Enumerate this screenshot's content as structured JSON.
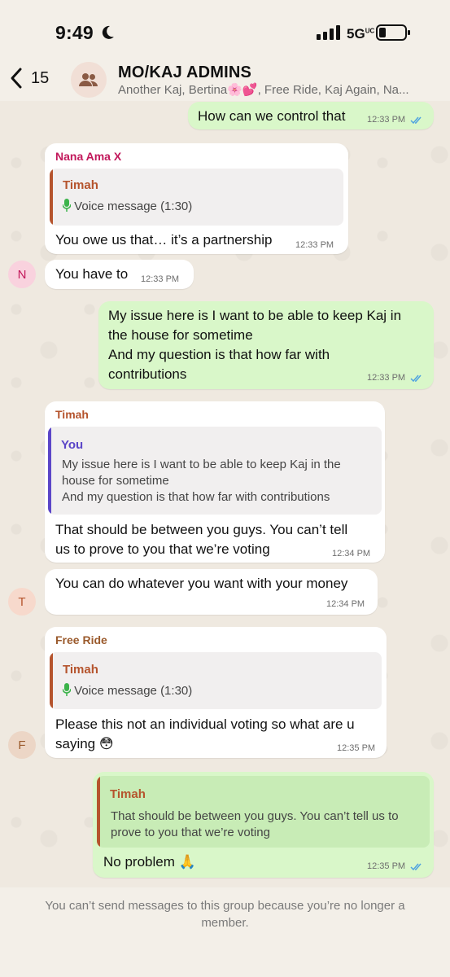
{
  "status_bar": {
    "time": "9:49",
    "network": "5G",
    "network_sup": "UC"
  },
  "header": {
    "back_count": "15",
    "title": "MO/KAJ ADMINS",
    "members": "Another Kaj, Bertina🌸💕, Free Ride, Kaj Again, Na..."
  },
  "messages": [
    {
      "text": "How can we control that",
      "time": "12:33 PM"
    },
    {
      "sender": "Nana Ama X",
      "quote_name": "Timah",
      "quote_text": "Voice message (1:30)",
      "text": "You owe us that… it’s a partnership",
      "time": "12:33 PM"
    },
    {
      "text": "You have to",
      "time": "12:33 PM",
      "avatar": "N"
    },
    {
      "lines": [
        "My issue here is I want to be able to keep Kaj in",
        "the house for sometime",
        "And my question is that how far with",
        "contributions"
      ],
      "time": "12:33 PM"
    },
    {
      "sender": "Timah",
      "quote_name": "You",
      "quote_lines": [
        "My issue here is I want to be able to keep Kaj in the",
        "house for sometime",
        "And my question is that how far with contributions"
      ],
      "lines": [
        "That should be between you guys. You can’t tell",
        "us to prove to you that we’re voting"
      ],
      "time": "12:34 PM"
    },
    {
      "text": "You can do whatever you want with your money",
      "time": "12:34 PM",
      "avatar": "T"
    },
    {
      "sender": "Free Ride",
      "quote_name": "Timah",
      "quote_text": "Voice message (1:30)",
      "lines": [
        "Please this not an individual voting so what are u",
        "saying 😳"
      ],
      "time": "12:35 PM",
      "avatar": "F"
    },
    {
      "quote_name": "Timah",
      "quote_lines": [
        "That should be between you guys. You can’t tell us to",
        "prove to you that we’re voting"
      ],
      "text": "No problem 🙏",
      "time": "12:35 PM"
    }
  ],
  "footer": {
    "notice": "You can’t send messages to this group because you’re no longer a member."
  },
  "colors": {
    "outgoing": "#d9f7c9",
    "incoming": "#ffffff",
    "tick": "#4fa3e0",
    "nana": "#c2185b",
    "timah": "#b5542d",
    "you": "#5b46c8",
    "freeride": "#9a5a2c",
    "mic": "#3bb34a"
  }
}
